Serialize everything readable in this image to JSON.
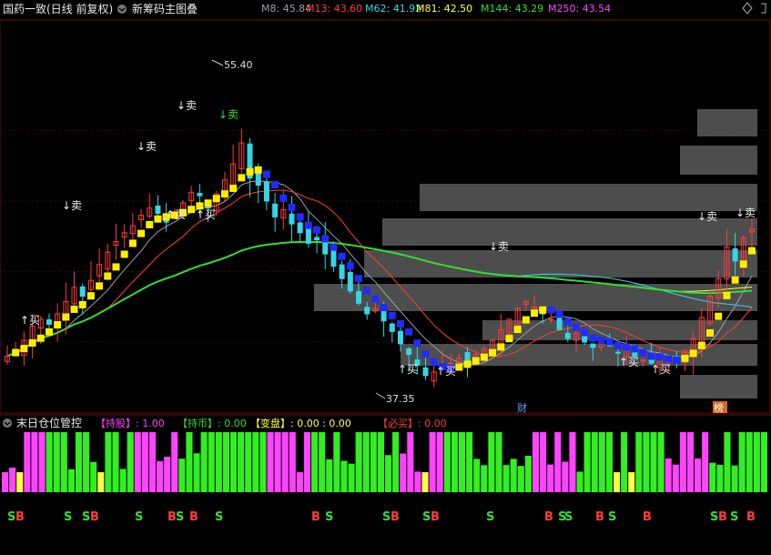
{
  "header": {
    "stock_title": "国药一致(日线 前复权)",
    "indicator_title": "新筹码主图叠",
    "ma_values": [
      {
        "label": "M8: 45.84",
        "color": "#9aa0a6"
      },
      {
        "label": "M13: 43.60",
        "color": "#ff3b3b"
      },
      {
        "label": "M62: 41.92",
        "color": "#33d6e6"
      },
      {
        "label": "M81: 42.50",
        "color": "#ffff44"
      },
      {
        "label": "M144: 43.29",
        "color": "#33dd33"
      },
      {
        "label": "M250: 43.54",
        "color": "#ff44ff"
      }
    ]
  },
  "sub_panel": {
    "title": "末日仓位管控",
    "items": [
      {
        "label": "【持股】: 1.00",
        "color": "#ff44ff"
      },
      {
        "label": "【持币】: 0.00",
        "color": "#33dd33"
      },
      {
        "label": "【变盘】: 0.00 : 0.00",
        "color": "#ffff44"
      },
      {
        "label": "【必买】: 0.00",
        "color": "#ff3b3b"
      }
    ]
  },
  "chart_data": {
    "type": "candlestick",
    "price_range": [
      37.35,
      55.4
    ],
    "annotations": {
      "high_label": "55.40",
      "low_label": "37.35",
      "markers": [
        "↓卖",
        "↓卖",
        "↓卖",
        "↓卖",
        "↓卖",
        "↓卖",
        "↓卖",
        "↑买",
        "↑买",
        "↑买",
        "↑买",
        "↑买",
        "↑买",
        "↑买"
      ],
      "event_icons": [
        "财",
        "榜"
      ]
    },
    "closes": [
      39.2,
      39.6,
      40.1,
      40.9,
      41.3,
      41.0,
      41.6,
      42.3,
      43.1,
      42.6,
      43.5,
      44.4,
      45.1,
      45.7,
      46.2,
      46.6,
      47.2,
      47.6,
      47.3,
      46.8,
      47.1,
      47.9,
      48.5,
      48.3,
      47.6,
      48.4,
      49.2,
      50.1,
      51.3,
      49.3,
      48.9,
      48.0,
      47.1,
      47.5,
      46.7,
      46.2,
      45.6,
      45.8,
      45.0,
      44.3,
      43.6,
      42.9,
      42.2,
      41.6,
      41.9,
      41.2,
      40.6,
      39.9,
      39.3,
      38.7,
      38.1,
      38.3,
      38.6,
      38.8,
      39.1,
      38.9,
      39.3,
      39.6,
      40.1,
      40.7,
      41.3,
      41.9,
      42.3,
      42.0,
      41.6,
      41.3,
      40.7,
      40.2,
      40.5,
      40.0,
      39.7,
      40.1,
      39.8,
      39.4,
      39.6,
      39.2,
      39.0,
      38.8,
      39.2,
      39.0,
      38.9,
      39.5,
      40.2,
      41.4,
      42.6,
      43.6,
      45.4,
      44.6,
      45.9,
      46.4
    ]
  },
  "signals": [
    "S3",
    "S",
    "S3",
    "S",
    "BS",
    "B",
    "S",
    "B S",
    "S3",
    "S3",
    "S",
    "B S",
    "S",
    "B",
    "S",
    "B",
    "S3",
    "S",
    "B"
  ]
}
